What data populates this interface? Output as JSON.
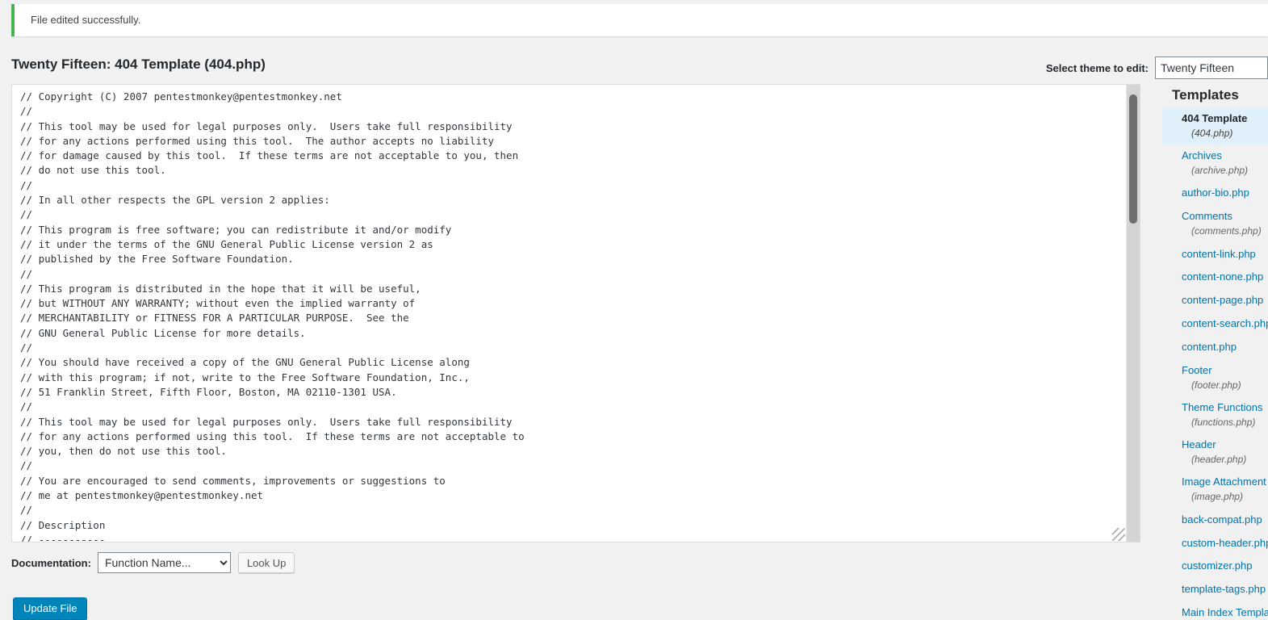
{
  "notice": {
    "message": "File edited successfully.",
    "accent_color": "#46b450"
  },
  "header": {
    "page_title": "Twenty Fifteen: 404 Template (404.php)",
    "theme_select_label": "Select theme to edit:",
    "theme_selected": "Twenty Fifteen"
  },
  "editor": {
    "code": "// Copyright (C) 2007 pentestmonkey@pentestmonkey.net\n//\n// This tool may be used for legal purposes only.  Users take full responsibility\n// for any actions performed using this tool.  The author accepts no liability\n// for damage caused by this tool.  If these terms are not acceptable to you, then\n// do not use this tool.\n//\n// In all other respects the GPL version 2 applies:\n//\n// This program is free software; you can redistribute it and/or modify\n// it under the terms of the GNU General Public License version 2 as\n// published by the Free Software Foundation.\n//\n// This program is distributed in the hope that it will be useful,\n// but WITHOUT ANY WARRANTY; without even the implied warranty of\n// MERCHANTABILITY or FITNESS FOR A PARTICULAR PURPOSE.  See the\n// GNU General Public License for more details.\n//\n// You should have received a copy of the GNU General Public License along\n// with this program; if not, write to the Free Software Foundation, Inc.,\n// 51 Franklin Street, Fifth Floor, Boston, MA 02110-1301 USA.\n//\n// This tool may be used for legal purposes only.  Users take full responsibility\n// for any actions performed using this tool.  If these terms are not acceptable to\n// you, then do not use this tool.\n//\n// You are encouraged to send comments, improvements or suggestions to\n// me at pentestmonkey@pentestmonkey.net\n//\n// Description\n// -----------"
  },
  "documentation": {
    "label": "Documentation:",
    "selected": "Function Name...",
    "lookup_label": "Look Up"
  },
  "submit": {
    "update_label": "Update File",
    "button_color": "#0085ba"
  },
  "sidebar": {
    "title": "Templates",
    "items": [
      {
        "name": "404 Template",
        "file": "(404.php)",
        "active": true
      },
      {
        "name": "Archives",
        "file": "(archive.php)",
        "active": false
      },
      {
        "name": "author-bio.php",
        "file": "",
        "active": false
      },
      {
        "name": "Comments",
        "file": "(comments.php)",
        "active": false
      },
      {
        "name": "content-link.php",
        "file": "",
        "active": false
      },
      {
        "name": "content-none.php",
        "file": "",
        "active": false
      },
      {
        "name": "content-page.php",
        "file": "",
        "active": false
      },
      {
        "name": "content-search.php",
        "file": "",
        "active": false
      },
      {
        "name": "content.php",
        "file": "",
        "active": false
      },
      {
        "name": "Footer",
        "file": "(footer.php)",
        "active": false
      },
      {
        "name": "Theme Functions",
        "file": "(functions.php)",
        "active": false
      },
      {
        "name": "Header",
        "file": "(header.php)",
        "active": false
      },
      {
        "name": "Image Attachment Template",
        "file": "(image.php)",
        "active": false
      },
      {
        "name": "back-compat.php",
        "file": "",
        "active": false
      },
      {
        "name": "custom-header.php",
        "file": "",
        "active": false
      },
      {
        "name": "customizer.php",
        "file": "",
        "active": false
      },
      {
        "name": "template-tags.php",
        "file": "",
        "active": false
      },
      {
        "name": "Main Index Template",
        "file": "",
        "active": false
      }
    ]
  }
}
